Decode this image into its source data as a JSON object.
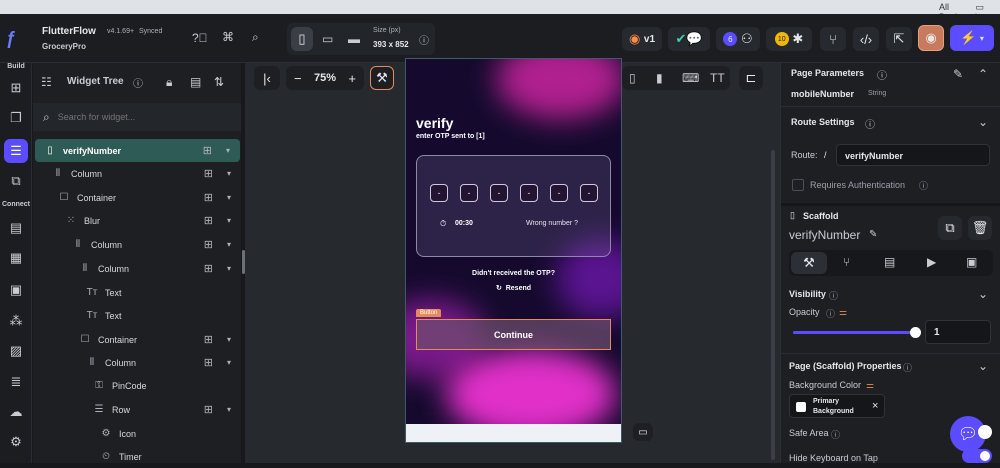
{
  "bookmarks": {
    "label": "All Bookmarks"
  },
  "app": {
    "name": "FlutterFlow",
    "version": "v4.1.69+",
    "status": "Synced",
    "project": "GroceryPro"
  },
  "device": {
    "size_label": "Size (px)",
    "size_value": "393 x 852"
  },
  "topbar": {
    "version_badge": "v1",
    "count1": "6",
    "count2": "10"
  },
  "rail": {
    "build": "Build",
    "connect": "Connect"
  },
  "tree": {
    "title": "Widget Tree",
    "search_placeholder": "Search for widget...",
    "items": [
      {
        "label": "verifyNumber"
      },
      {
        "label": "Column"
      },
      {
        "label": "Container"
      },
      {
        "label": "Blur"
      },
      {
        "label": "Column"
      },
      {
        "label": "Column"
      },
      {
        "label": "Text"
      },
      {
        "label": "Text"
      },
      {
        "label": "Container"
      },
      {
        "label": "Column"
      },
      {
        "label": "PinCode"
      },
      {
        "label": "Row"
      },
      {
        "label": "Icon"
      },
      {
        "label": "Timer"
      }
    ]
  },
  "zoom": {
    "value": "75%"
  },
  "phone": {
    "title": "verify",
    "subtitle": "enter OTP sent to [1]",
    "pin_chars": [
      "-",
      "-",
      "-",
      "-",
      "-",
      "-"
    ],
    "timer": "00:30",
    "wrong_number": "Wrong number ?",
    "not_received": "Didn't received the OTP?",
    "resend": "Resend",
    "button_tag": "Button",
    "continue": "Continue"
  },
  "right": {
    "page_params": "Page Parameters",
    "param_name": "mobileNumber",
    "param_type": "String",
    "route_settings": "Route Settings",
    "route_label": "Route:",
    "route_slash": "/",
    "route_value": "verifyNumber",
    "requires_auth": "Requires Authentication",
    "scaffold": "Scaffold",
    "scaffold_name": "verifyNumber",
    "visibility": "Visibility",
    "opacity": "Opacity",
    "opacity_value": "1",
    "opacity_level": 1,
    "page_props": "Page (Scaffold) Properties",
    "bg_color": "Background Color",
    "bg_value": "Primary Background",
    "safe_area": "Safe Area",
    "hide_keyboard": "Hide Keyboard on Tap"
  },
  "colors": {
    "accent": "#5b4dff",
    "tree_selected": "#2f5b57",
    "button_orange": "#e58b5a"
  }
}
